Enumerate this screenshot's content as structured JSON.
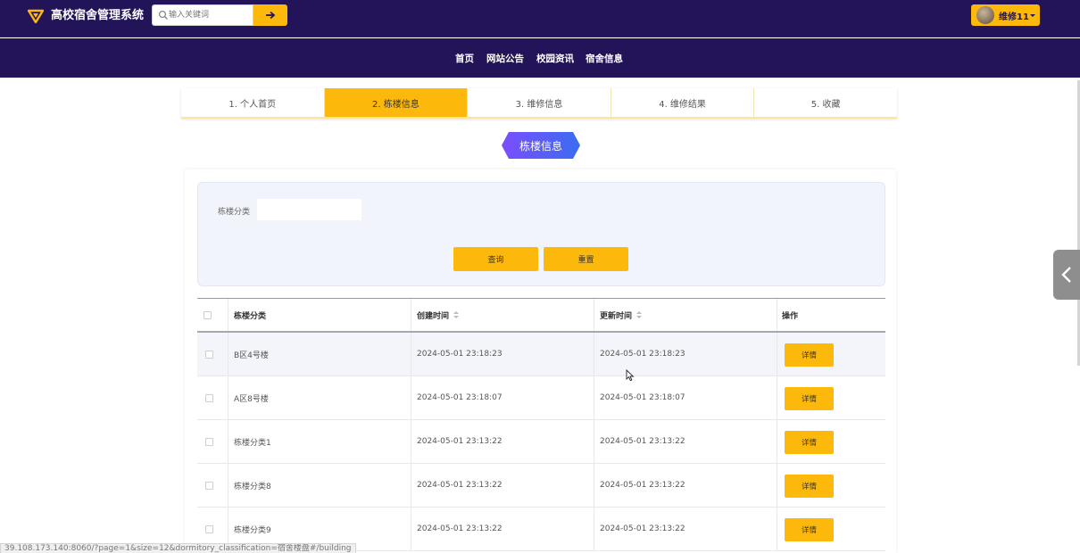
{
  "header": {
    "site_title": "高校宿舍管理系统",
    "search_placeholder": "输入关键词",
    "user_name": "维修11"
  },
  "nav": [
    "首页",
    "网站公告",
    "校园资讯",
    "宿舍信息"
  ],
  "steps": [
    {
      "label": "1. 个人首页",
      "active": false
    },
    {
      "label": "2. 栋楼信息",
      "active": true
    },
    {
      "label": "3. 维修信息",
      "active": false
    },
    {
      "label": "4. 维修结果",
      "active": false
    },
    {
      "label": "5. 收藏",
      "active": false
    }
  ],
  "section_title": "栋楼信息",
  "filter": {
    "label": "栋楼分类",
    "value": "",
    "query_btn": "查询",
    "reset_btn": "重置"
  },
  "table": {
    "columns": [
      "栋楼分类",
      "创建时间",
      "更新时间",
      "操作"
    ],
    "rows": [
      {
        "category": "B区4号楼",
        "created": "2024-05-01 23:18:23",
        "updated": "2024-05-01 23:18:23",
        "action": "详情"
      },
      {
        "category": "A区8号楼",
        "created": "2024-05-01 23:18:07",
        "updated": "2024-05-01 23:18:07",
        "action": "详情"
      },
      {
        "category": "栋楼分类1",
        "created": "2024-05-01 23:13:22",
        "updated": "2024-05-01 23:13:22",
        "action": "详情"
      },
      {
        "category": "栋楼分类8",
        "created": "2024-05-01 23:13:22",
        "updated": "2024-05-01 23:13:22",
        "action": "详情"
      },
      {
        "category": "栋楼分类9",
        "created": "2024-05-01 23:13:22",
        "updated": "2024-05-01 23:13:22",
        "action": "详情"
      }
    ]
  },
  "status_url": "39.108.173.140:8060/?page=1&size=12&dormitory_classification=宿舍楼盘#/building",
  "colors": {
    "header_bg": "#231459",
    "accent": "#fdb80c",
    "title_badge_from": "#7b4dff",
    "title_badge_to": "#3a6df0"
  },
  "icons": {
    "logo": "logo-icon",
    "search": "search-icon",
    "search_go": "arrow-right-icon",
    "side_toggle": "chevron-left-icon"
  }
}
